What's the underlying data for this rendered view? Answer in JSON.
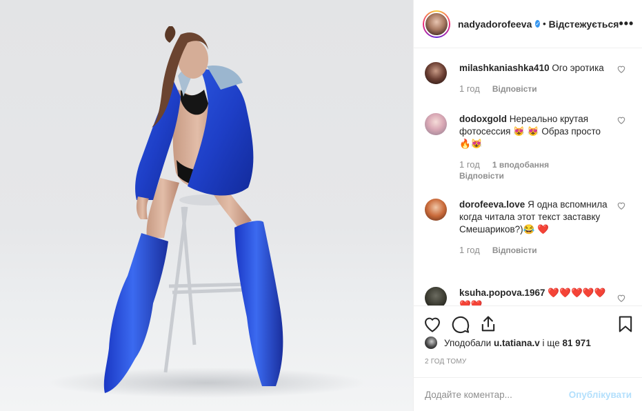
{
  "post": {
    "photo_description_icon": "photo-image",
    "author": "nadyadorofeeva",
    "follow_state": "Відстежується",
    "dot": "•",
    "more_icon": "more-horizontal-icon"
  },
  "comments": [
    {
      "username": "milashkaniashka410",
      "text": "Ого эротика",
      "time": "1 год",
      "reply": "Відповісти"
    },
    {
      "username": "dodoxgold",
      "text": "Нереально крутая фотосессия 😻 😻 Образ просто 🔥😻",
      "time": "1 год",
      "likes": "1 вподобання",
      "reply": "Відповісти"
    },
    {
      "username": "dorofeeva.love",
      "text": "Я одна вспомнила когда читала этот текст заставку Смешариков?)😂 ❤️",
      "time": "1 год",
      "reply": "Відповісти"
    },
    {
      "username": "ksuha.popova.1967",
      "text": "❤️❤️❤️❤️❤️❤️❤️"
    }
  ],
  "likes_line": {
    "prefix": "Уподобали",
    "user": "u.tatiana.v",
    "middle": "і ще",
    "count": "81 971"
  },
  "time_ago": "2 ГОД ТОМУ",
  "comment_box": {
    "placeholder": "Додайте коментар...",
    "publish_label": "Опублікувати"
  },
  "colors": {
    "accent": "#3897f0",
    "publish_disabled": "#b2dffc",
    "muted": "#8e8e8e",
    "heart": "#e0245e"
  }
}
